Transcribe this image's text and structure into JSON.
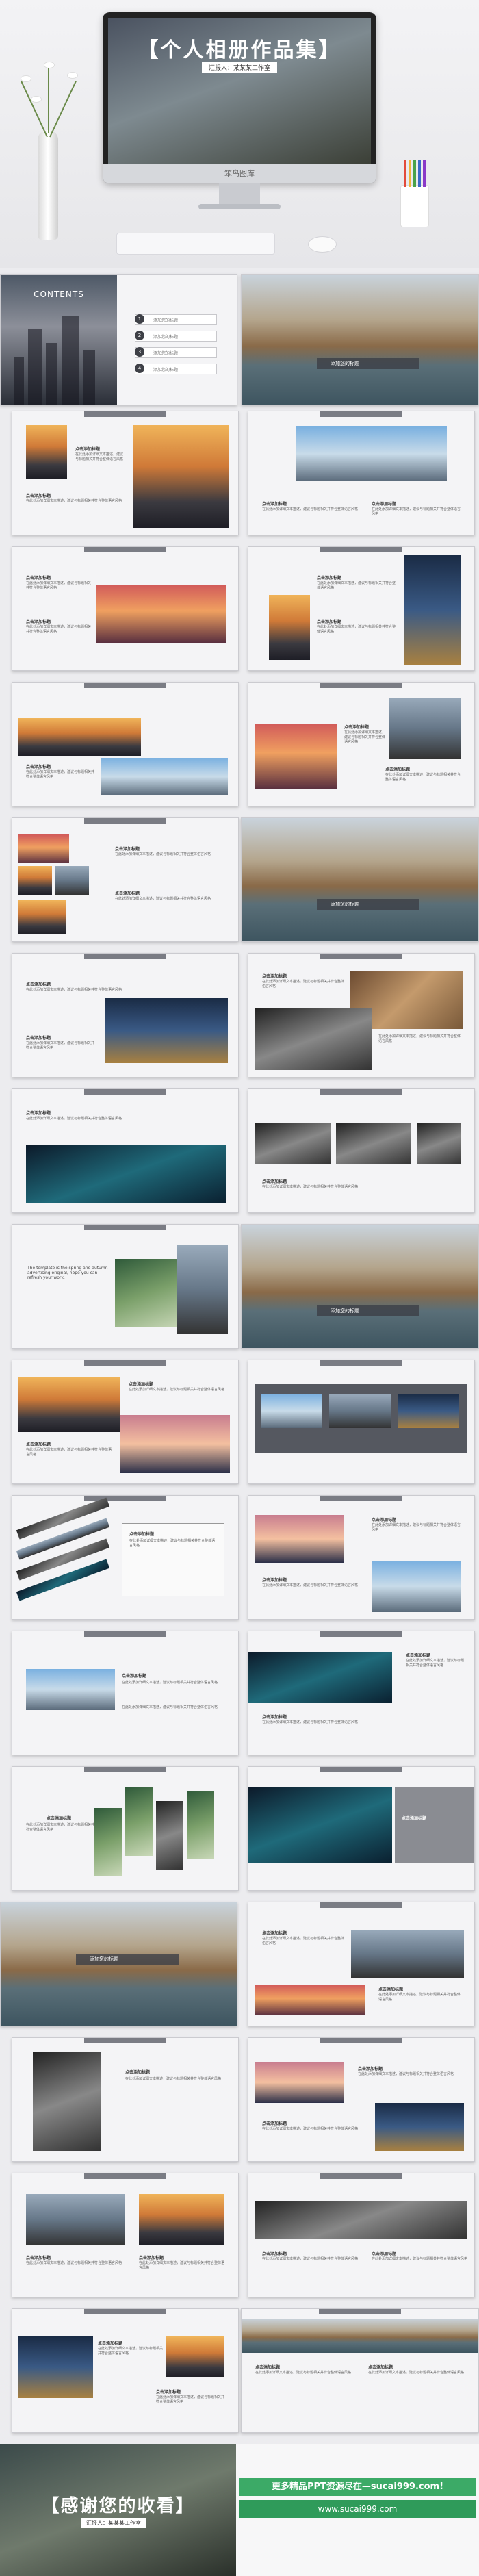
{
  "hero": {
    "title": "【个人相册作品集】",
    "subtitle": "汇报人：某某某工作室",
    "brand": "笨鸟图库"
  },
  "contents": {
    "title": "CONTENTS",
    "items": [
      "1",
      "2",
      "3",
      "4"
    ],
    "item_label": "添加您的标题"
  },
  "venice": {
    "title": "添加您的标题"
  },
  "slide_text": {
    "heading": "点击添加标题",
    "body": "在此处添加详细文本描述，建议与标题相关并符合整体语言风格"
  },
  "quote_text": "The template is the spring and autumn advertising original, hope you can refresh your work.",
  "end": {
    "title": "【感谢您的收看】",
    "subtitle": "汇报人：某某某工作室",
    "ad_line1": "更多精品PPT资源尽在—sucai999.com!",
    "ad_line2": "www.sucai999.com"
  }
}
